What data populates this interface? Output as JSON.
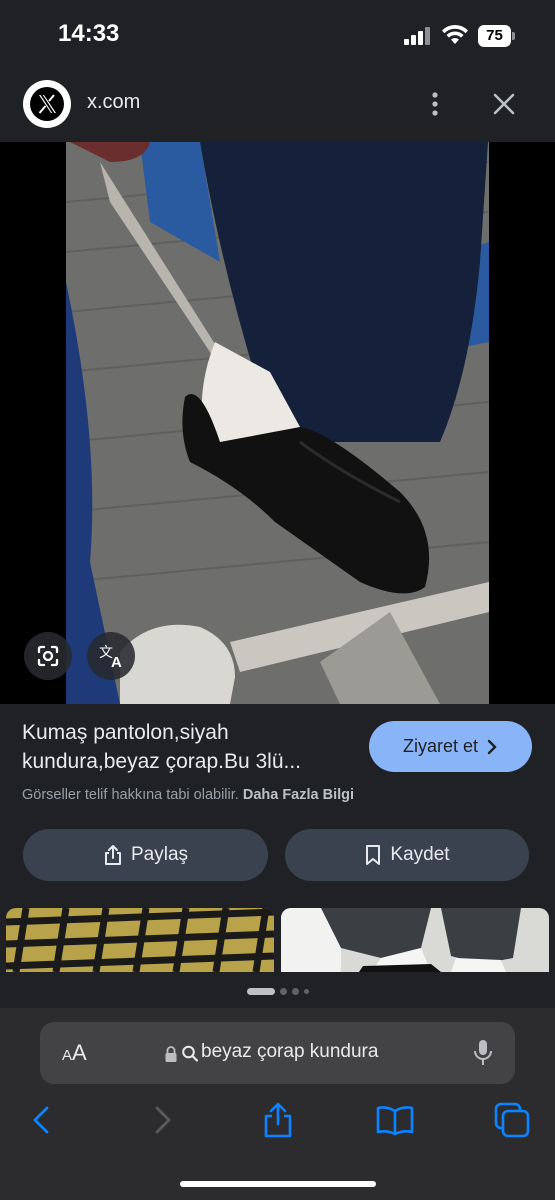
{
  "status_bar": {
    "time": "14:33",
    "battery": "75"
  },
  "source": {
    "site": "x.com",
    "logo": "x-logo-icon"
  },
  "image": {
    "description_icons": [
      "lens-icon",
      "translate-icon"
    ]
  },
  "result": {
    "title": "Kumaş pantolon,siyah kundura,beyaz çorap.Bu 3lü...",
    "visit_label": "Ziyaret et",
    "copyright_text": "Görseller telif hakkına tabi olabilir.",
    "more_info_link": "Daha Fazla Bilgi",
    "share_label": "Paylaş",
    "save_label": "Kaydet"
  },
  "pager": {
    "pages": 4,
    "active": 0
  },
  "browser": {
    "aa_label_small": "A",
    "aa_label": "A",
    "address": "beyaz çorap kundura"
  },
  "colors": {
    "accent": "#8ab4f8",
    "panel": "#1f2125",
    "button": "#3a4250",
    "link": "#0a84ff"
  }
}
